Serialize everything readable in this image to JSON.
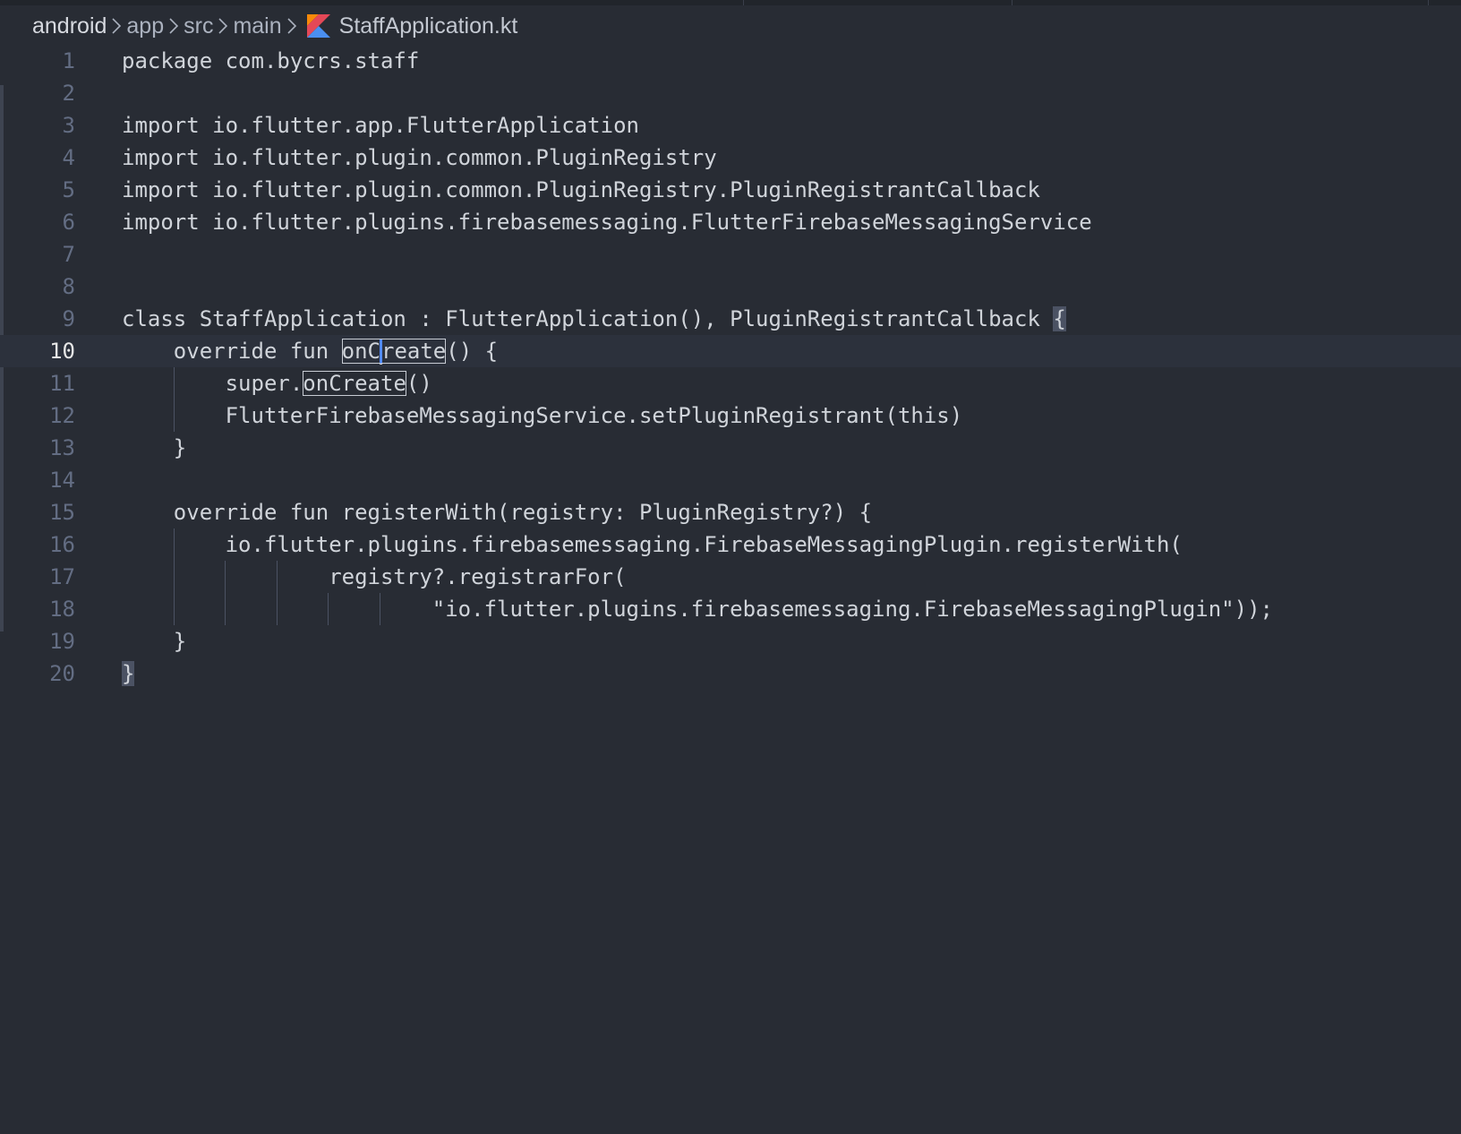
{
  "breadcrumb": {
    "segments": [
      "android",
      "app",
      "src",
      "main"
    ],
    "file": "StaffApplication.kt"
  },
  "editor": {
    "current_line": 10,
    "lines": [
      {
        "n": "1",
        "text": "package com.bycrs.staff"
      },
      {
        "n": "2",
        "text": ""
      },
      {
        "n": "3",
        "text": "import io.flutter.app.FlutterApplication"
      },
      {
        "n": "4",
        "text": "import io.flutter.plugin.common.PluginRegistry"
      },
      {
        "n": "5",
        "text": "import io.flutter.plugin.common.PluginRegistry.PluginRegistrantCallback"
      },
      {
        "n": "6",
        "text": "import io.flutter.plugins.firebasemessaging.FlutterFirebaseMessagingService"
      },
      {
        "n": "7",
        "text": ""
      },
      {
        "n": "8",
        "text": ""
      },
      {
        "n": "9",
        "text": "class StaffApplication : FlutterApplication(), PluginRegistrantCallback ",
        "brace": "{"
      },
      {
        "n": "10",
        "pre": "    override fun ",
        "hl_a": "onC",
        "hl_b": "reate",
        "post": "() {"
      },
      {
        "n": "11",
        "pre": "        super.",
        "hl": "onCreate",
        "post": "()"
      },
      {
        "n": "12",
        "text": "        FlutterFirebaseMessagingService.setPluginRegistrant(this)"
      },
      {
        "n": "13",
        "text": "    }"
      },
      {
        "n": "14",
        "text": ""
      },
      {
        "n": "15",
        "text": "    override fun registerWith(registry: PluginRegistry?) {"
      },
      {
        "n": "16",
        "text": "        io.flutter.plugins.firebasemessaging.FirebaseMessagingPlugin.registerWith("
      },
      {
        "n": "17",
        "text": "                registry?.registrarFor("
      },
      {
        "n": "18",
        "text": "                        \"io.flutter.plugins.firebasemessaging.FirebaseMessagingPlugin\"));"
      },
      {
        "n": "19",
        "text": "    }"
      },
      {
        "n": "20",
        "brace": "}"
      }
    ]
  },
  "colors": {
    "background": "#282c34",
    "text": "#d0d4da",
    "line_number": "#636d83",
    "caret": "#528bff",
    "kotlin_icon_orange": "#f88909",
    "kotlin_icon_blue": "#4a8ff0"
  },
  "icons": {
    "file_type": "kotlin-file-icon",
    "separator": "chevron-right-icon"
  }
}
